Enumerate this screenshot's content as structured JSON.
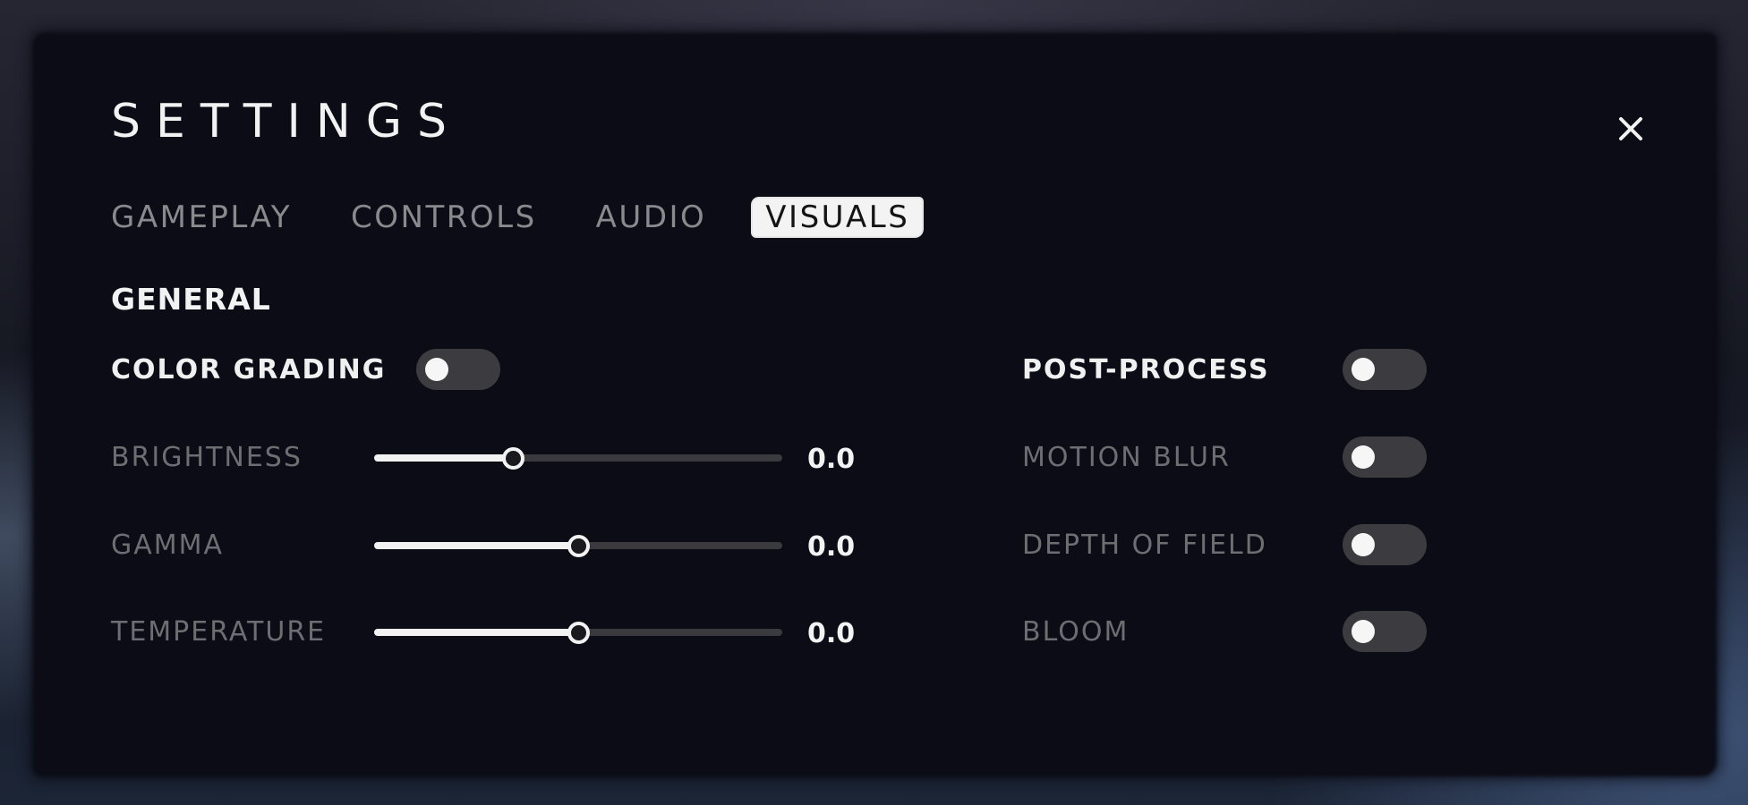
{
  "header": {
    "title": "SETTINGS",
    "close_icon": "close-icon"
  },
  "tabs": [
    {
      "label": "GAMEPLAY",
      "active": false
    },
    {
      "label": "CONTROLS",
      "active": false
    },
    {
      "label": "AUDIO",
      "active": false
    },
    {
      "label": "VISUALS",
      "active": true
    }
  ],
  "section": {
    "title": "GENERAL"
  },
  "left_settings": {
    "color_grading": {
      "label": "COLOR GRADING",
      "enabled": false
    },
    "sliders": [
      {
        "label": "BRIGHTNESS",
        "value": "0.0",
        "fill_fraction": 0.34
      },
      {
        "label": "GAMMA",
        "value": "0.0",
        "fill_fraction": 0.5
      },
      {
        "label": "TEMPERATURE",
        "value": "0.0",
        "fill_fraction": 0.5
      }
    ]
  },
  "right_settings": {
    "post_process": {
      "label": "POST-PROCESS",
      "enabled": false
    },
    "toggles": [
      {
        "label": "MOTION BLUR",
        "enabled": false
      },
      {
        "label": "DEPTH OF FIELD",
        "enabled": false
      },
      {
        "label": "BLOOM",
        "enabled": false
      }
    ]
  },
  "colors": {
    "panel_bg": "#0b0c15",
    "text_primary": "#f2f2f2",
    "text_dim": "#6e6e72",
    "toggle_track": "#3c3c40",
    "slider_track": "#3a3a3e"
  }
}
